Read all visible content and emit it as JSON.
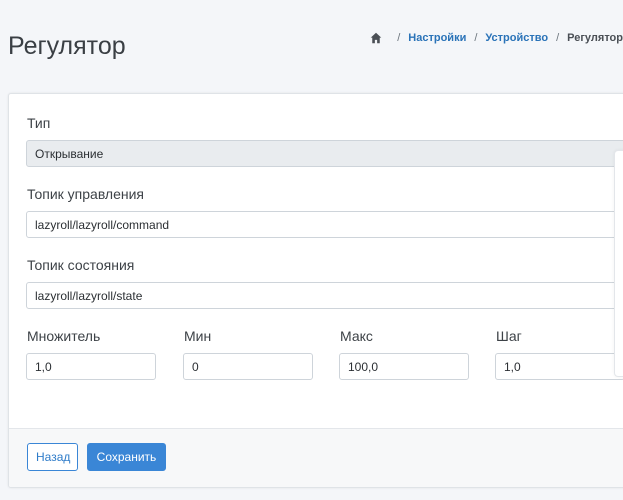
{
  "page": {
    "title": "Регулятор"
  },
  "breadcrumb": {
    "items": [
      "Настройки",
      "Устройство",
      "Регулятор"
    ]
  },
  "form": {
    "type": {
      "label": "Тип",
      "value": "Открывание"
    },
    "control_topic": {
      "label": "Топик управления",
      "value": "lazyroll/lazyroll/command"
    },
    "state_topic": {
      "label": "Топик состояния",
      "value": "lazyroll/lazyroll/state"
    },
    "multiplier": {
      "label": "Множитель",
      "value": "1,0"
    },
    "min": {
      "label": "Мин",
      "value": "0"
    },
    "max": {
      "label": "Макс",
      "value": "100,0"
    },
    "step": {
      "label": "Шаг",
      "value": "1,0"
    }
  },
  "footer": {
    "back_label": "Назад",
    "save_label": "Сохранить"
  },
  "icons": {
    "home": "home-icon",
    "select_arrow": "chevron-down-icon"
  },
  "colors": {
    "primary": "#3a86d6",
    "link": "#2a73b8"
  }
}
